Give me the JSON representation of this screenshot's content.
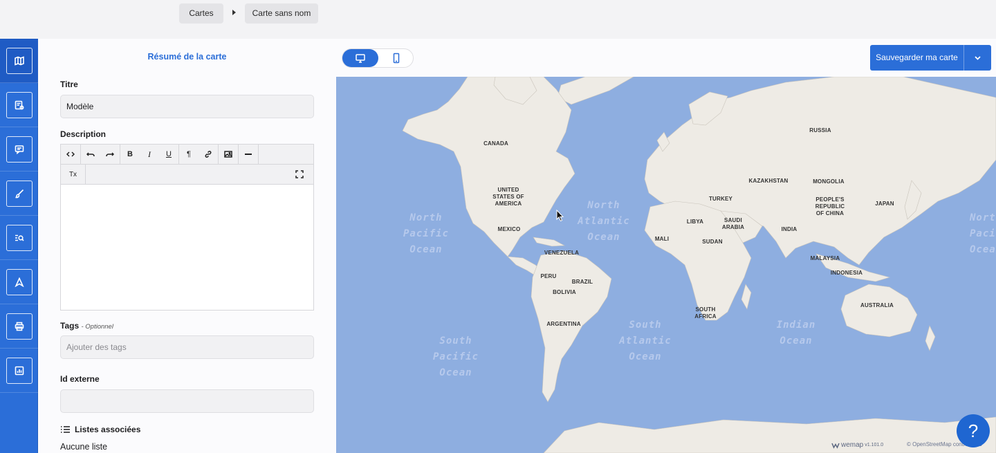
{
  "breadcrumb": {
    "items": [
      "Cartes",
      "Carte sans nom"
    ]
  },
  "sidebar": {
    "items": [
      {
        "icon": "map-icon",
        "active": true
      },
      {
        "icon": "filter-list-icon",
        "active": false
      },
      {
        "icon": "comment-icon",
        "active": false
      },
      {
        "icon": "brush-icon",
        "active": false
      },
      {
        "icon": "search-list-icon",
        "active": false
      },
      {
        "icon": "navigation-icon",
        "active": false
      },
      {
        "icon": "print-icon",
        "active": false
      },
      {
        "icon": "stats-icon",
        "active": false
      }
    ]
  },
  "panel": {
    "title": "Résumé de la carte",
    "title_label": "Titre",
    "title_value": "Modèle",
    "description_label": "Description",
    "tags_label": "Tags",
    "tags_optional": "- Optionnel",
    "tags_placeholder": "Ajouter des tags",
    "external_id_label": "Id externe",
    "external_id_value": "",
    "lists_label": "Listes associées",
    "no_list": "Aucune liste"
  },
  "editor_toolbar": {
    "row1": [
      "code-view-icon",
      "undo-icon",
      "redo-icon",
      "bold-icon",
      "italic-icon",
      "underline-icon",
      "paragraph-icon",
      "link-icon",
      "image-icon",
      "horizontal-rule-icon"
    ],
    "row2": [
      "clear-format-icon",
      "fullscreen-icon"
    ],
    "bold": "B",
    "italic": "I",
    "underline": "U",
    "paragraph": "¶",
    "clear": "Tx"
  },
  "map_header": {
    "view_modes": [
      "desktop-icon",
      "mobile-icon"
    ],
    "active_view": "desktop",
    "save_label": "Sauvegarder ma carte"
  },
  "map": {
    "oceans": {
      "north_pacific": "North Pacific Ocean",
      "north_atlantic": "North Atlantic Ocean",
      "south_pacific": "South Pacific Ocean",
      "south_atlantic": "South Atlantic Ocean",
      "indian": "Indian Ocean",
      "north_pacific_east": "North Pacific Ocean"
    },
    "countries": {
      "canada": "CANADA",
      "usa": "UNITED STATES OF AMERICA",
      "mexico": "MEXICO",
      "venezuela": "VENEZUELA",
      "peru": "PERU",
      "brazil": "BRAZIL",
      "bolivia": "BOLIVIA",
      "argentina": "ARGENTINA",
      "russia": "RUSSIA",
      "kazakhstan": "KAZAKHSTAN",
      "mongolia": "MONGOLIA",
      "turkey": "TURKEY",
      "china": "PEOPLE'S REPUBLIC OF CHINA",
      "japan": "JAPAN",
      "libya": "LIBYA",
      "saudi": "SAUDI ARABIA",
      "india": "INDIA",
      "mali": "MALI",
      "sudan": "SUDAN",
      "malaysia": "MALAYSIA",
      "indonesia": "INDONESIA",
      "australia": "AUSTRALIA",
      "south_africa": "SOUTH AFRICA"
    },
    "brand": "wemap",
    "version": "v1.101.0",
    "attribution": "© OpenStreetMap contributors"
  },
  "help": {
    "label": "?"
  }
}
